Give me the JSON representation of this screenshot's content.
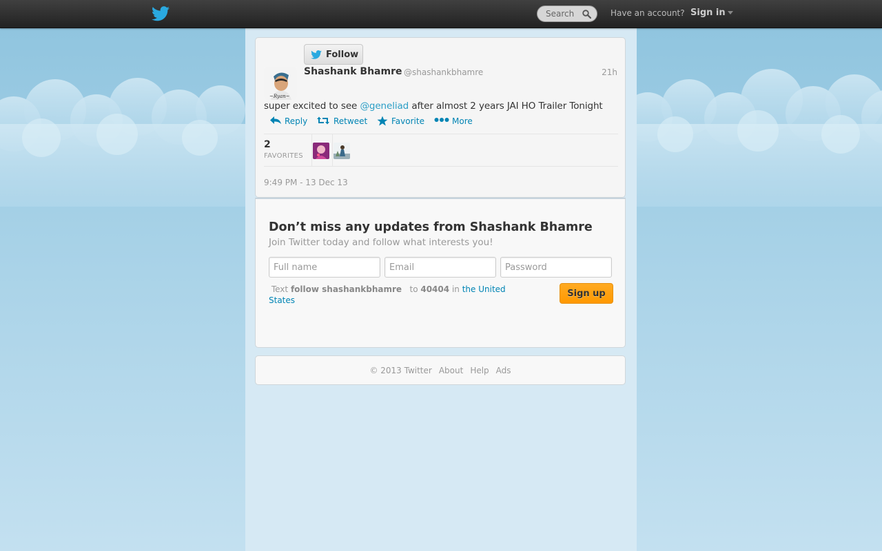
{
  "topbar": {
    "search_placeholder": "Search",
    "have_account": "Have an account?",
    "sign_in": "Sign in"
  },
  "tweet": {
    "follow_label": "Follow",
    "author_name": "Shashank Bhamre",
    "author_handle": "@shashankbhamre",
    "time_ago": "21h",
    "text_before": "super excited to see ",
    "mention": "@geneliad",
    "text_after": " after almost 2 years JAI HO Trailer Tonight",
    "actions": {
      "reply": "Reply",
      "retweet": "Retweet",
      "favorite": "Favorite",
      "more": "More"
    },
    "favorites_count": "2",
    "favorites_label": "FAVORITES",
    "timestamp": "9:49 PM - 13 Dec 13"
  },
  "signup": {
    "title": "Don’t miss any updates from Shashank Bhamre",
    "subtitle": "Join Twitter today and follow what interests you!",
    "fullname_placeholder": "Full name",
    "email_placeholder": "Email",
    "password_placeholder": "Password",
    "sms_text": "Text",
    "sms_command": "follow shashankbhamre",
    "sms_to": "to",
    "sms_number": "40404",
    "sms_in": "in",
    "sms_country": "the United States",
    "signup_label": "Sign up"
  },
  "footer": {
    "copyright": "© 2013 Twitter",
    "about": "About",
    "help": "Help",
    "ads": "Ads"
  },
  "colors": {
    "link": "#0084b4",
    "mention": "#2b9ec6",
    "signup_button": "#ff9900",
    "topbar": "#2b2b2b"
  }
}
